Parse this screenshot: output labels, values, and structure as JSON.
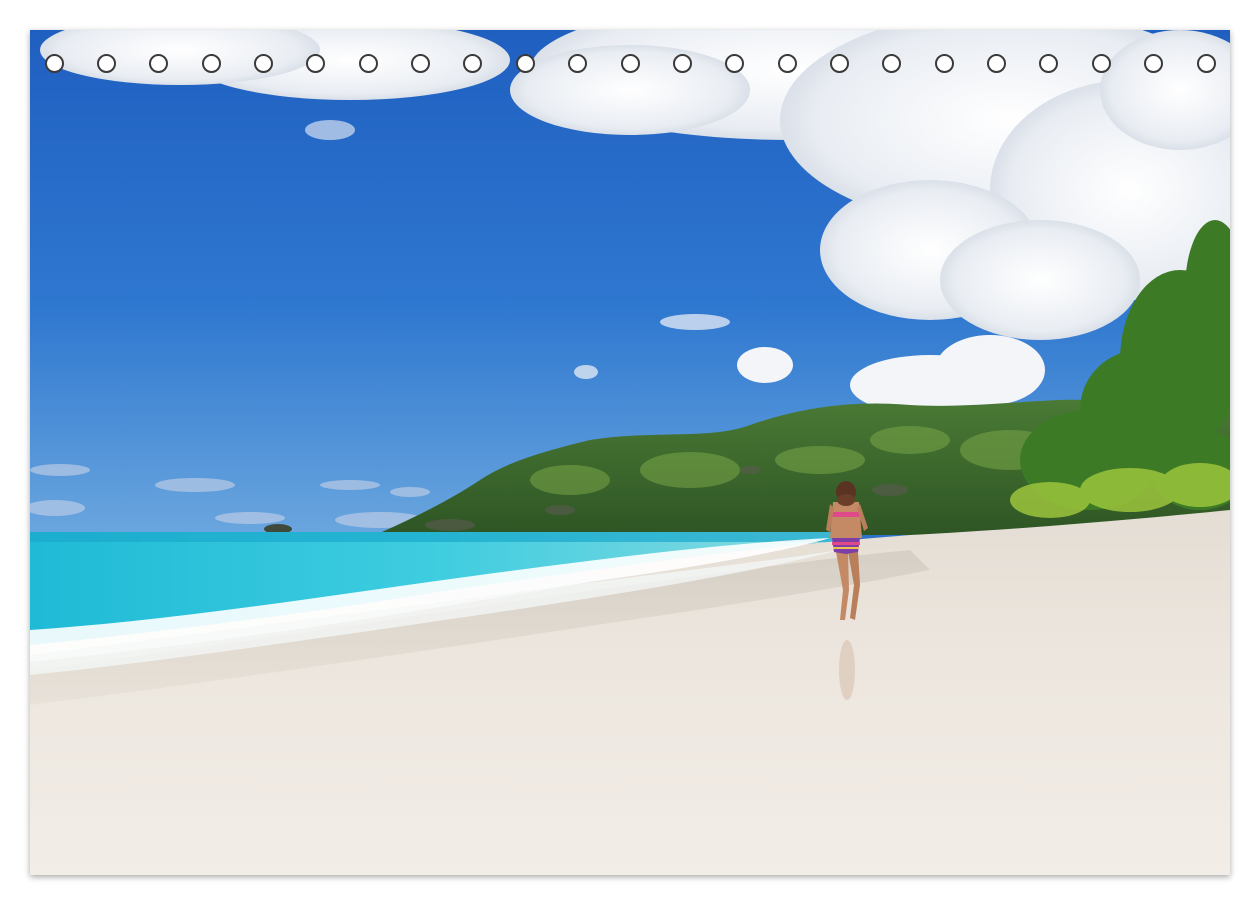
{
  "calendar": {
    "binding_hole_count": 23,
    "photo_subject": "tropical-beach-with-woman-walking",
    "colors": {
      "sky": "#2f72c9",
      "sea": "#27c0d6",
      "sand": "#eae4dc",
      "vegetation": "#3c6b2c",
      "cloud": "#f2f4f7"
    }
  }
}
